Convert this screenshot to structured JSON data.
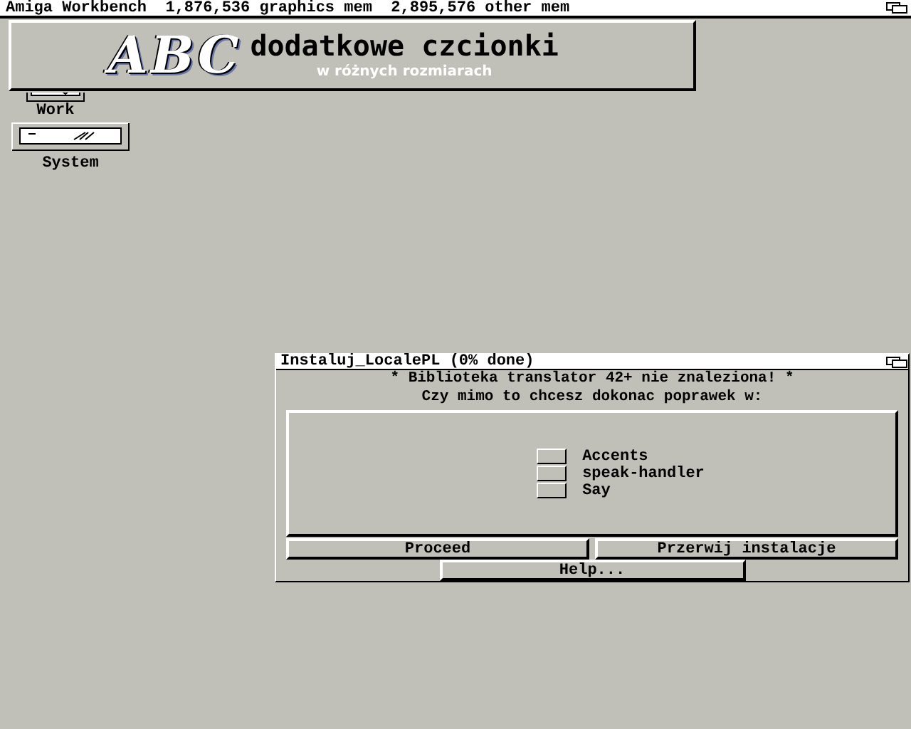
{
  "screen_title": "Amiga Workbench  1,876,536 graphics mem  2,895,576 other mem",
  "banner": {
    "logo": "ABC",
    "title": "dodatkowe czcionki",
    "subtitle": "w różnych rozmiarach"
  },
  "icons": [
    {
      "label": "Work"
    },
    {
      "label": "System"
    }
  ],
  "window": {
    "title": "Instaluj_LocalePL (0% done)",
    "message": [
      "* Biblioteka translator 42+ nie znaleziona! *",
      "Czy mimo to chcesz dokonac poprawek w:"
    ],
    "options": [
      {
        "label": "Accents",
        "checked": false
      },
      {
        "label": "speak-handler",
        "checked": false
      },
      {
        "label": "Say",
        "checked": false
      }
    ],
    "buttons": [
      "Proceed",
      "Przerwij instalacje"
    ],
    "help_button": "Help..."
  }
}
